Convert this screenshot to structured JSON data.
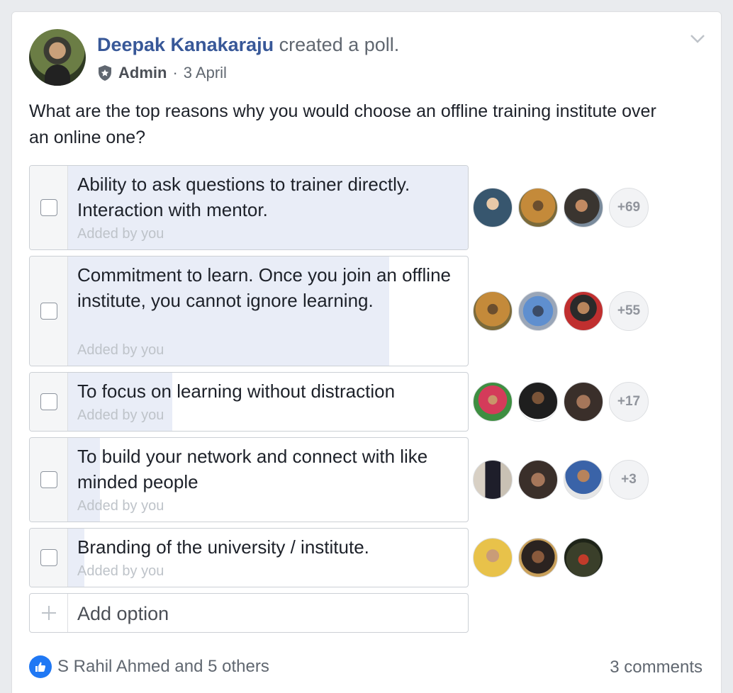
{
  "post": {
    "author": "Deepak Kanakaraju",
    "action": "created a poll.",
    "role": "Admin",
    "separator": "·",
    "date": "3 April",
    "question": "What are the top reasons why you would choose an offline training institute over an online one?"
  },
  "poll": {
    "options": [
      {
        "text": "Ability to ask questions to trainer directly. Interaction with mentor.",
        "added_by": "Added by you",
        "more_votes": "+69",
        "vote_share": 1.0
      },
      {
        "text": "Commitment to learn. Once you join an offline institute, you cannot ignore learning.",
        "added_by": "Added by you",
        "more_votes": "+55",
        "vote_share": 0.8
      },
      {
        "text": "To focus on learning without distraction",
        "added_by": "Added by you",
        "more_votes": "+17",
        "vote_share": 0.26
      },
      {
        "text": "To build your network and connect with like minded people",
        "added_by": "Added by you",
        "more_votes": "+3",
        "vote_share": 0.08
      },
      {
        "text": "Branding of the university / institute.",
        "added_by": "Added by you",
        "more_votes": "",
        "vote_share": 0.04
      }
    ],
    "add_option_label": "Add option"
  },
  "footer": {
    "likes_text": "S Rahil Ahmed and 5 others",
    "comments_text": "3 comments"
  },
  "icons": {
    "admin_badge": "shield-icon",
    "menu": "chevron-down-icon",
    "add": "plus-icon",
    "reaction": "like-icon"
  },
  "colors": {
    "author_link": "#385898",
    "poll_fill": "#e9edf7",
    "like_blue": "#2078f4"
  }
}
